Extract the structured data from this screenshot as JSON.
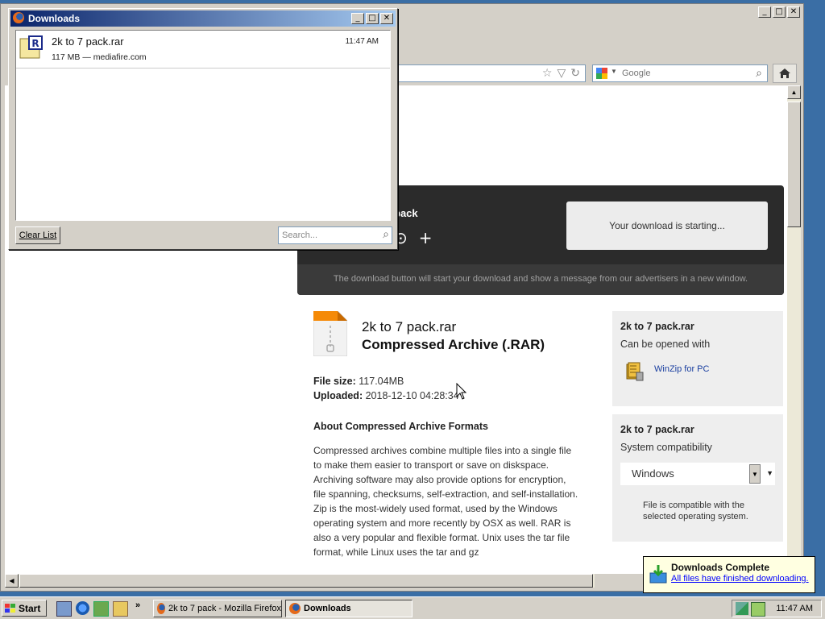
{
  "firefox": {
    "search_placeholder": "Google",
    "download": {
      "name": "pack",
      "starting_msg": "Your download is starting...",
      "note": "The download button will start your download and show a message from our advertisers in a new window."
    },
    "file": {
      "name": "2k to 7 pack.rar",
      "type": "Compressed Archive (.RAR)",
      "size_label": "File size:",
      "size_value": "117.04MB",
      "uploaded_label": "Uploaded:",
      "uploaded_value": "2018-12-10 04:28:34"
    },
    "about": {
      "heading": "About Compressed Archive Formats",
      "text": "Compressed archives combine multiple files into a single file to make them easier to transport or save on diskspace. Archiving software may also provide options for encryption, file spanning, checksums, self-extraction, and self-installation. Zip is the most-widely used format, used by the Windows operating system and more recently by OSX as well. RAR is also a very popular and flexible format. Unix uses the tar file format, while Linux uses the tar and gz"
    },
    "card1": {
      "title": "2k to 7 pack.rar",
      "sub": "Can be opened with",
      "app": "WinZip for PC"
    },
    "card2": {
      "title": "2k to 7 pack.rar",
      "sub": "System compatibility",
      "os": "Windows",
      "note": "File is compatible with the selected operating system."
    }
  },
  "downloads_window": {
    "title": "Downloads",
    "items": [
      {
        "name": "2k to 7 pack.rar",
        "meta": "117 MB — mediafire.com",
        "time": "11:47 AM"
      }
    ],
    "clear_label": "Clear List",
    "search_placeholder": "Search..."
  },
  "notification": {
    "title": "Downloads Complete",
    "message": "All files have finished downloading."
  },
  "taskbar": {
    "start": "Start",
    "tasks": [
      {
        "label": "2k to 7 pack - Mozilla Firefox"
      },
      {
        "label": "Downloads"
      }
    ],
    "clock": "11:47 AM"
  }
}
